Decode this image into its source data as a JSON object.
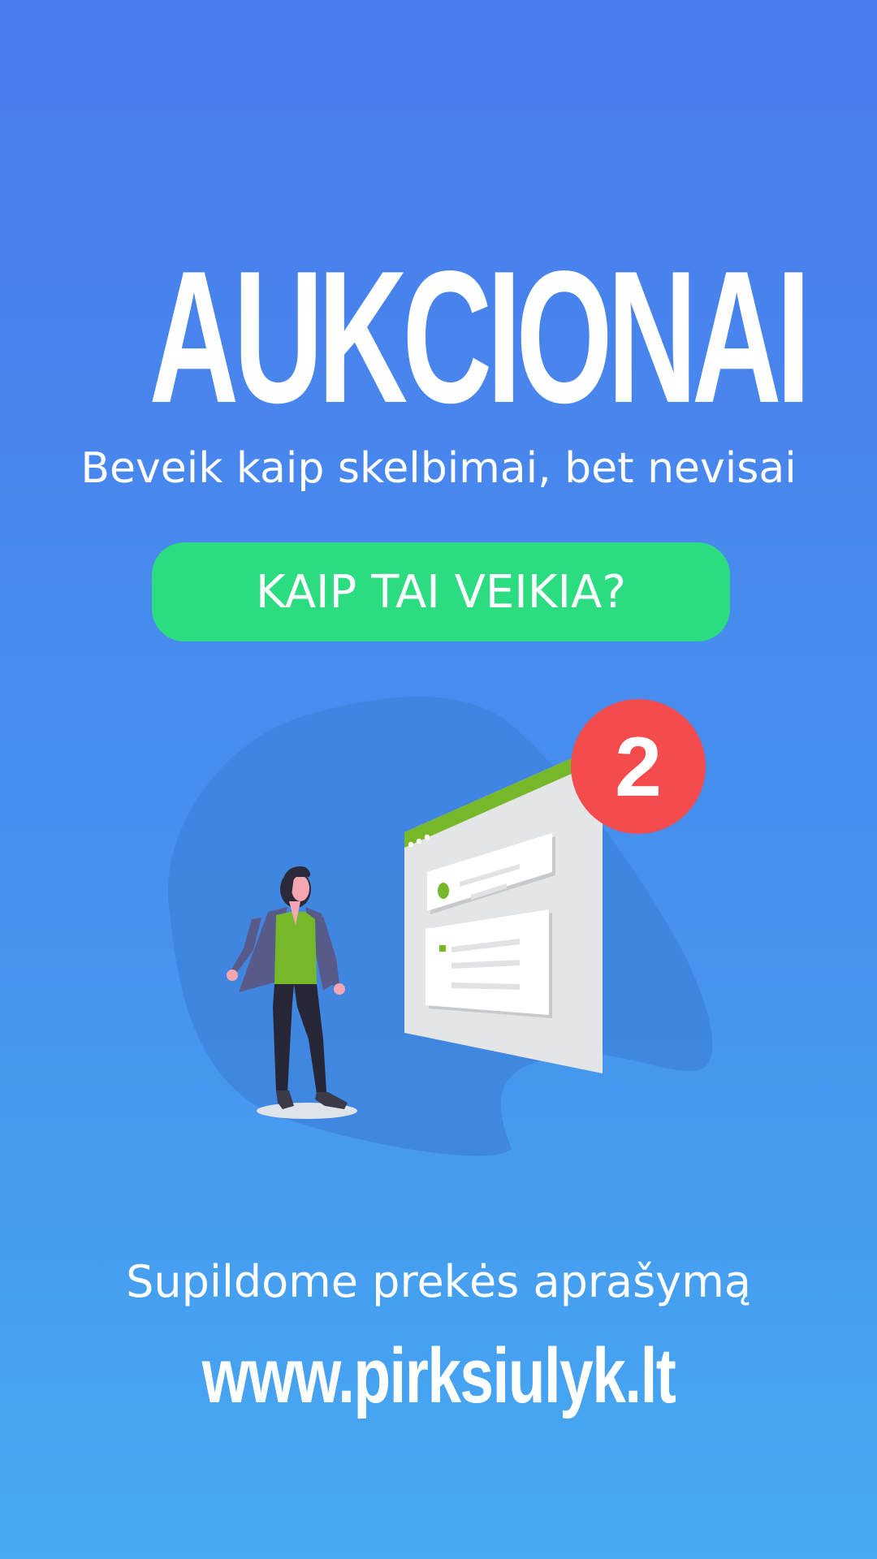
{
  "hero": {
    "title": "AUKCIONAI",
    "subtitle": "Beveik kaip skelbimai, bet nevisai"
  },
  "cta": {
    "label": "KAIP TAI VEIKIA?",
    "color": "#2bdd80"
  },
  "illustration": {
    "step_badge": "2",
    "badge_color": "#f44c4c",
    "accent_color": "#76b82a"
  },
  "step": {
    "caption": "Supildome prekės aprašymą"
  },
  "footer": {
    "url": "www.pirksiulyk.lt"
  },
  "colors": {
    "background_top": "#4a7cec",
    "background_bottom": "#46a9f2"
  }
}
